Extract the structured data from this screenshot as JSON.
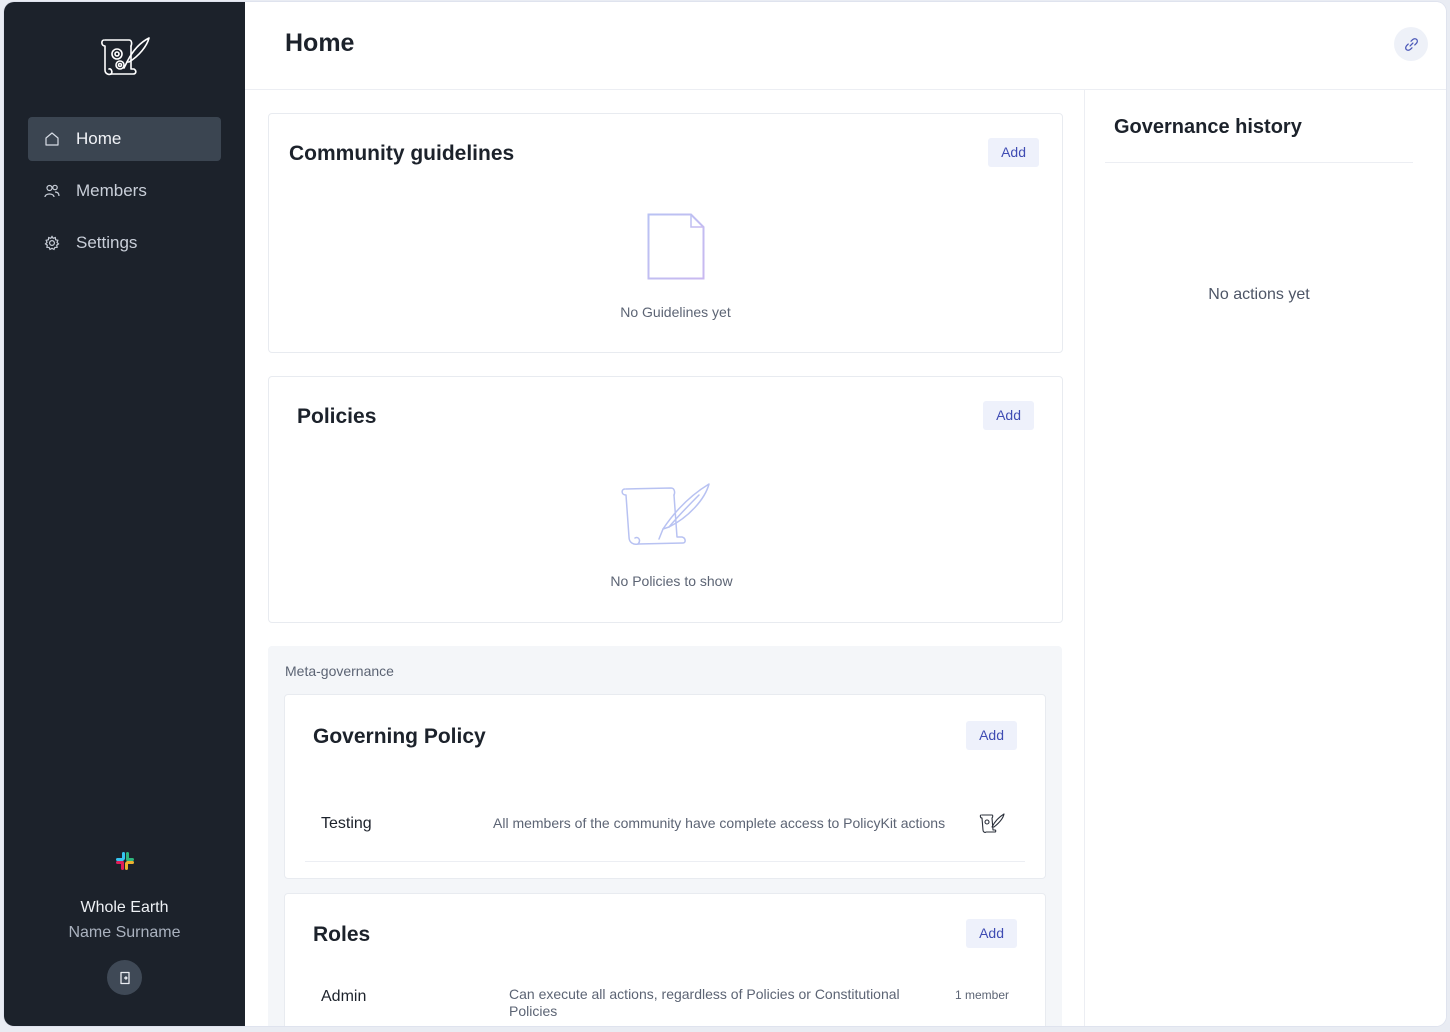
{
  "sidebar": {
    "nav": [
      {
        "label": "Home",
        "icon": "home-icon",
        "active": true
      },
      {
        "label": "Members",
        "icon": "members-icon",
        "active": false
      },
      {
        "label": "Settings",
        "icon": "settings-icon",
        "active": false
      }
    ],
    "workspace_name": "Whole Earth",
    "user_name": "Name Surname"
  },
  "header": {
    "title": "Home"
  },
  "guidelines": {
    "title": "Community guidelines",
    "add_label": "Add",
    "empty_text": "No Guidelines yet"
  },
  "policies": {
    "title": "Policies",
    "add_label": "Add",
    "empty_text": "No Policies to show"
  },
  "meta_governance": {
    "label": "Meta-governance",
    "governing_policy": {
      "title": "Governing Policy",
      "add_label": "Add",
      "rows": [
        {
          "name": "Testing",
          "description": "All members of the community have complete access to PolicyKit actions"
        }
      ]
    },
    "roles": {
      "title": "Roles",
      "add_label": "Add",
      "rows": [
        {
          "name": "Admin",
          "description": "Can execute all actions, regardless of Policies or Constitutional Policies",
          "count": "1 member"
        }
      ]
    }
  },
  "governance_history": {
    "title": "Governance history",
    "empty_text": "No actions yet"
  },
  "colors": {
    "sidebar_bg": "#1c222b",
    "active_nav": "#3b4551",
    "accent": "#3f4cb3",
    "add_button_bg": "#eef1fb"
  }
}
